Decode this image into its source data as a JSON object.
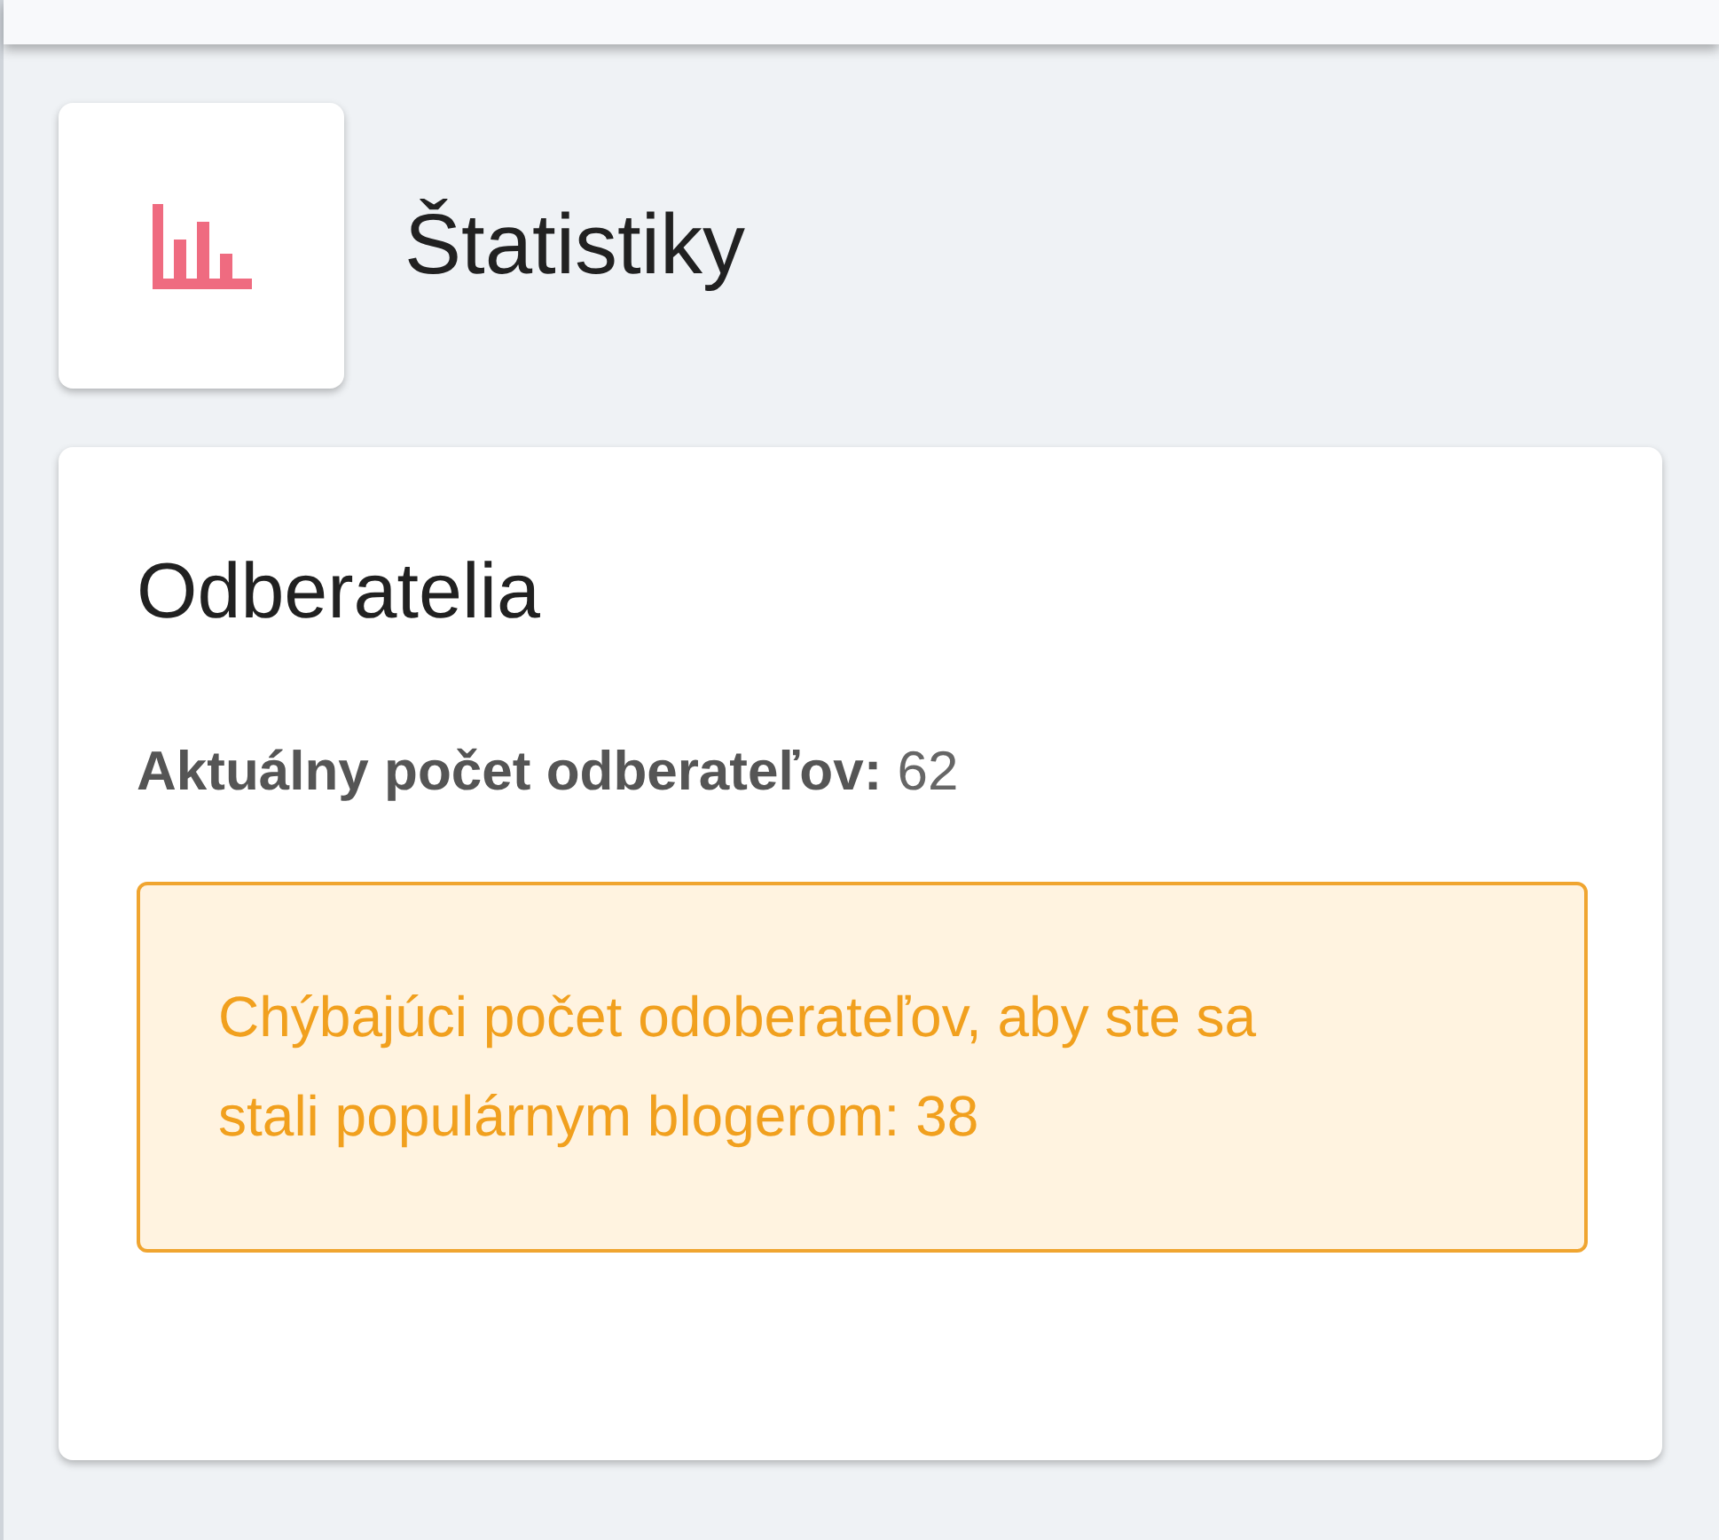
{
  "page_title": "Štatistiky",
  "card": {
    "title": "Odberatelia",
    "stat": "**Aktuálny počet odberateľov:** 62",
    "alert": "Chýbajúci počet odoberateľov, aby ste sa stali populárnym blogerom: 38"
  }
}
